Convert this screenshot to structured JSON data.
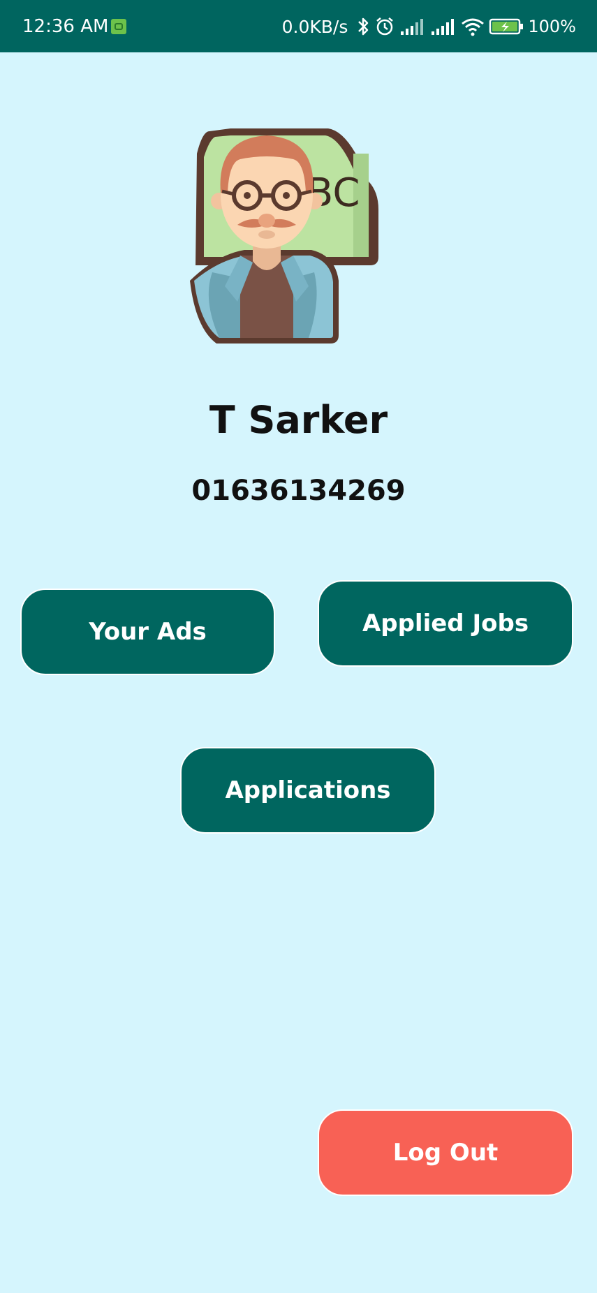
{
  "status_bar": {
    "time": "12:36 AM",
    "network_speed": "0.0KB/s",
    "battery_percent": "100%",
    "icons": [
      "app-notification-icon",
      "bluetooth-icon",
      "alarm-icon",
      "signal-icon",
      "signal-icon",
      "wifi-icon",
      "battery-charging-icon"
    ]
  },
  "avatar": {
    "board_text": "ABC"
  },
  "profile": {
    "name": "T Sarker",
    "phone": "01636134269"
  },
  "buttons": {
    "your_ads": "Your Ads",
    "applied_jobs": "Applied Jobs",
    "applications": "Applications",
    "logout": "Log Out"
  },
  "colors": {
    "background": "#d5f5fd",
    "status_bar": "#00655f",
    "primary_button": "#00665f",
    "logout_button": "#f86155"
  }
}
